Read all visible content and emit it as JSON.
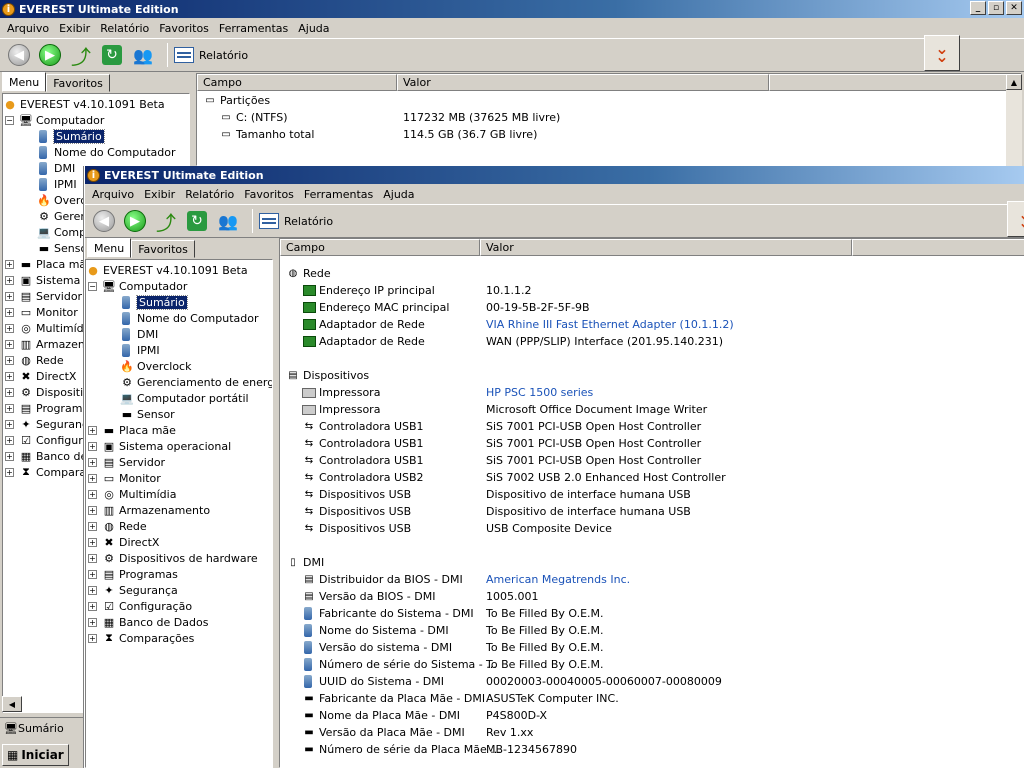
{
  "app_title": "EVEREST Ultimate Edition",
  "menu": [
    "Arquivo",
    "Exibir",
    "Relatório",
    "Favoritos",
    "Ferramentas",
    "Ajuda"
  ],
  "toolbar": {
    "report_label": "Relatório"
  },
  "tabs": [
    "Menu",
    "Favoritos"
  ],
  "columns": {
    "field": "Campo",
    "value": "Valor"
  },
  "back_window": {
    "tree_root": "EVEREST v4.10.1091 Beta",
    "tree_computer": "Computador",
    "tree_children": [
      "Sumário",
      "Nome do Computador",
      "DMI",
      "IPMI",
      "Overc",
      "Gerer",
      "Comp",
      "Senso"
    ],
    "tree_top": [
      "Placa mãe",
      "Sistema o",
      "Servidor",
      "Monitor",
      "Multimídia",
      "Armazena",
      "Rede",
      "DirectX",
      "Dispositiv",
      "Programa",
      "Seguranç",
      "Configura",
      "Banco de",
      "Compara"
    ],
    "partitions_section": "Partições",
    "partitions": [
      {
        "field": "C: (NTFS)",
        "value": "117232 MB (37625 MB livre)"
      },
      {
        "field": "Tamanho total",
        "value": "114.5 GB (36.7 GB livre)"
      }
    ],
    "status_text": "Sumário",
    "start_label": "Iniciar"
  },
  "front_window": {
    "tree_root": "EVEREST v4.10.1091 Beta",
    "tree_computer": "Computador",
    "tree_children": [
      "Sumário",
      "Nome do Computador",
      "DMI",
      "IPMI",
      "Overclock",
      "Gerenciamento de energia",
      "Computador portátil",
      "Sensor"
    ],
    "tree_top": [
      "Placa mãe",
      "Sistema operacional",
      "Servidor",
      "Monitor",
      "Multimídia",
      "Armazenamento",
      "Rede",
      "DirectX",
      "Dispositivos de hardware",
      "Programas",
      "Segurança",
      "Configuração",
      "Banco de Dados",
      "Comparações"
    ],
    "sections": [
      {
        "title": "Rede",
        "rows": [
          {
            "field": "Endereço IP principal",
            "value": "10.1.1.2",
            "link": false
          },
          {
            "field": "Endereço MAC principal",
            "value": "00-19-5B-2F-5F-9B",
            "link": false
          },
          {
            "field": "Adaptador de Rede",
            "value": "VIA Rhine III Fast Ethernet Adapter  (10.1.1.2)",
            "link": true
          },
          {
            "field": "Adaptador de Rede",
            "value": "WAN (PPP/SLIP) Interface  (201.95.140.231)",
            "link": false
          }
        ]
      },
      {
        "title": "Dispositivos",
        "rows": [
          {
            "field": "Impressora",
            "value": "HP PSC 1500 series",
            "link": true
          },
          {
            "field": "Impressora",
            "value": "Microsoft Office Document Image Writer",
            "link": false
          },
          {
            "field": "Controladora USB1",
            "value": "SiS 7001 PCI-USB Open Host Controller",
            "link": false
          },
          {
            "field": "Controladora USB1",
            "value": "SiS 7001 PCI-USB Open Host Controller",
            "link": false
          },
          {
            "field": "Controladora USB1",
            "value": "SiS 7001 PCI-USB Open Host Controller",
            "link": false
          },
          {
            "field": "Controladora USB2",
            "value": "SiS 7002 USB 2.0 Enhanced Host Controller",
            "link": false
          },
          {
            "field": "Dispositivos USB",
            "value": "Dispositivo de interface humana USB",
            "link": false
          },
          {
            "field": "Dispositivos USB",
            "value": "Dispositivo de interface humana USB",
            "link": false
          },
          {
            "field": "Dispositivos USB",
            "value": "USB Composite Device",
            "link": false
          }
        ]
      },
      {
        "title": "DMI",
        "rows": [
          {
            "field": "Distribuidor da BIOS - DMI",
            "value": "American Megatrends Inc.",
            "link": true
          },
          {
            "field": "Versão da BIOS - DMI",
            "value": "1005.001",
            "link": false
          },
          {
            "field": "Fabricante do Sistema - DMI",
            "value": "To Be Filled By O.E.M.",
            "link": false
          },
          {
            "field": "Nome do Sistema - DMI",
            "value": "To Be Filled By O.E.M.",
            "link": false
          },
          {
            "field": "Versão do sistema - DMI",
            "value": "To Be Filled By O.E.M.",
            "link": false
          },
          {
            "field": "Número de série do Sistema - ...",
            "value": "To Be Filled By O.E.M.",
            "link": false
          },
          {
            "field": "UUID do Sistema - DMI",
            "value": "00020003-00040005-00060007-00080009",
            "link": false
          },
          {
            "field": "Fabricante da Placa Mãe - DMI",
            "value": "ASUSTeK Computer INC.",
            "link": false
          },
          {
            "field": "Nome da Placa Mãe - DMI",
            "value": "P4S800D-X",
            "link": false
          },
          {
            "field": "Versão da Placa Mãe - DMI",
            "value": "Rev 1.xx",
            "link": false
          },
          {
            "field": "Número de série da Placa Mãe ...",
            "value": "MB-1234567890",
            "link": false
          }
        ]
      }
    ]
  }
}
